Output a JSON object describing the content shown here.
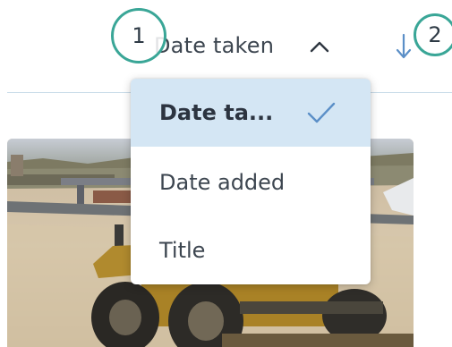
{
  "sort_bar": {
    "current_sort_label": "Date taken",
    "expanded_icon": "chevron-up-icon",
    "direction_icon": "arrow-down-icon"
  },
  "callouts": {
    "first": "1",
    "second": "2"
  },
  "sort_menu": {
    "items": [
      {
        "label": "Date ta...",
        "selected": true
      },
      {
        "label": "Date added",
        "selected": false
      },
      {
        "label": "Title",
        "selected": false
      }
    ],
    "selected_icon": "check-icon"
  },
  "photo": {
    "subject_icon": "construction-grader-photo"
  },
  "colors": {
    "accent": "#3aa697",
    "selected_bg": "#d4e6f4",
    "icon_blue": "#5b8fc7",
    "text": "#3d4650"
  }
}
